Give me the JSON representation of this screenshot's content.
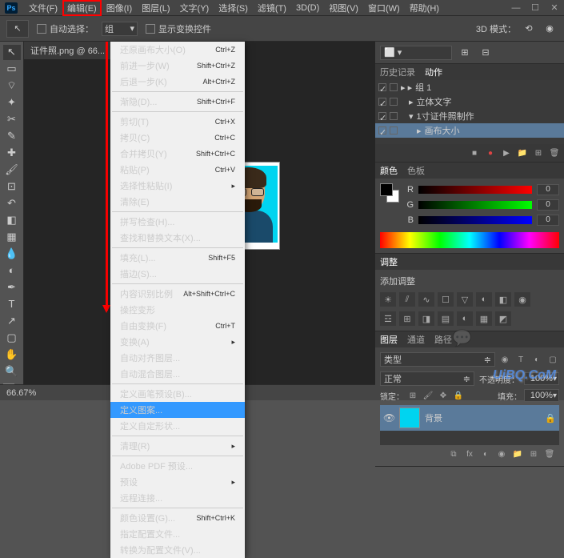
{
  "menubar": {
    "items": [
      "文件(F)",
      "编辑(E)",
      "图像(I)",
      "图层(L)",
      "文字(Y)",
      "选择(S)",
      "滤镜(T)",
      "3D(D)",
      "视图(V)",
      "窗口(W)",
      "帮助(H)"
    ]
  },
  "optbar": {
    "auto_select": "自动选择：",
    "group": "组",
    "show_transform": "显示变换控件",
    "mode_3d": "3D 模式："
  },
  "tab": {
    "title": "证件照.png @ 66..."
  },
  "dropdown": {
    "items": [
      {
        "label": "还原画布大小(O)",
        "shortcut": "Ctrl+Z",
        "type": "item"
      },
      {
        "label": "前进一步(W)",
        "shortcut": "Shift+Ctrl+Z",
        "type": "item"
      },
      {
        "label": "后退一步(K)",
        "shortcut": "Alt+Ctrl+Z",
        "type": "item"
      },
      {
        "type": "sep"
      },
      {
        "label": "渐隐(D)...",
        "shortcut": "Shift+Ctrl+F",
        "type": "item"
      },
      {
        "type": "sep"
      },
      {
        "label": "剪切(T)",
        "shortcut": "Ctrl+X",
        "type": "item"
      },
      {
        "label": "拷贝(C)",
        "shortcut": "Ctrl+C",
        "type": "item"
      },
      {
        "label": "合并拷贝(Y)",
        "shortcut": "Shift+Ctrl+C",
        "type": "item"
      },
      {
        "label": "粘贴(P)",
        "shortcut": "Ctrl+V",
        "type": "item"
      },
      {
        "label": "选择性粘贴(I)",
        "shortcut": "",
        "type": "sub"
      },
      {
        "label": "清除(E)",
        "shortcut": "",
        "type": "item"
      },
      {
        "type": "sep"
      },
      {
        "label": "拼写检查(H)...",
        "shortcut": "",
        "type": "item"
      },
      {
        "label": "查找和替换文本(X)...",
        "shortcut": "",
        "type": "item"
      },
      {
        "type": "sep"
      },
      {
        "label": "填充(L)...",
        "shortcut": "Shift+F5",
        "type": "item"
      },
      {
        "label": "描边(S)...",
        "shortcut": "",
        "type": "item"
      },
      {
        "type": "sep"
      },
      {
        "label": "内容识别比例",
        "shortcut": "Alt+Shift+Ctrl+C",
        "type": "item"
      },
      {
        "label": "操控变形",
        "shortcut": "",
        "type": "item"
      },
      {
        "label": "自由变换(F)",
        "shortcut": "Ctrl+T",
        "type": "item"
      },
      {
        "label": "变换(A)",
        "shortcut": "",
        "type": "sub"
      },
      {
        "label": "自动对齐图层...",
        "shortcut": "",
        "type": "item"
      },
      {
        "label": "自动混合图层...",
        "shortcut": "",
        "type": "item"
      },
      {
        "type": "sep"
      },
      {
        "label": "定义画笔预设(B)...",
        "shortcut": "",
        "type": "item"
      },
      {
        "label": "定义图案...",
        "shortcut": "",
        "type": "highlight"
      },
      {
        "label": "定义自定形状...",
        "shortcut": "",
        "type": "item"
      },
      {
        "type": "sep"
      },
      {
        "label": "清理(R)",
        "shortcut": "",
        "type": "sub"
      },
      {
        "type": "sep"
      },
      {
        "label": "Adobe PDF 预设...",
        "shortcut": "",
        "type": "item"
      },
      {
        "label": "预设",
        "shortcut": "",
        "type": "sub"
      },
      {
        "label": "远程连接...",
        "shortcut": "",
        "type": "item"
      },
      {
        "type": "sep"
      },
      {
        "label": "颜色设置(G)...",
        "shortcut": "Shift+Ctrl+K",
        "type": "item"
      },
      {
        "label": "指定配置文件...",
        "shortcut": "",
        "type": "item"
      },
      {
        "label": "转换为配置文件(V)...",
        "shortcut": "",
        "type": "item"
      }
    ]
  },
  "history_panel": {
    "tabs": [
      "历史记录",
      "动作"
    ],
    "items": [
      "组 1",
      "立体文字",
      "1寸证件照制作",
      "画布大小"
    ]
  },
  "color_panel": {
    "tabs": [
      "颜色",
      "色板"
    ],
    "r": "0",
    "g": "0",
    "b": "0"
  },
  "adjust_panel": {
    "tab": "调整",
    "title": "添加调整"
  },
  "layers_panel": {
    "tabs": [
      "图层",
      "通道",
      "路径"
    ],
    "kind": "类型",
    "blend": "正常",
    "opacity_label": "不透明度：",
    "opacity": "100%",
    "lock_label": "锁定：",
    "fill_label": "填充：",
    "fill": "100%",
    "layer_name": "背景"
  },
  "status": {
    "zoom": "66.67%"
  },
  "watermark": "UiBQ.CoM"
}
